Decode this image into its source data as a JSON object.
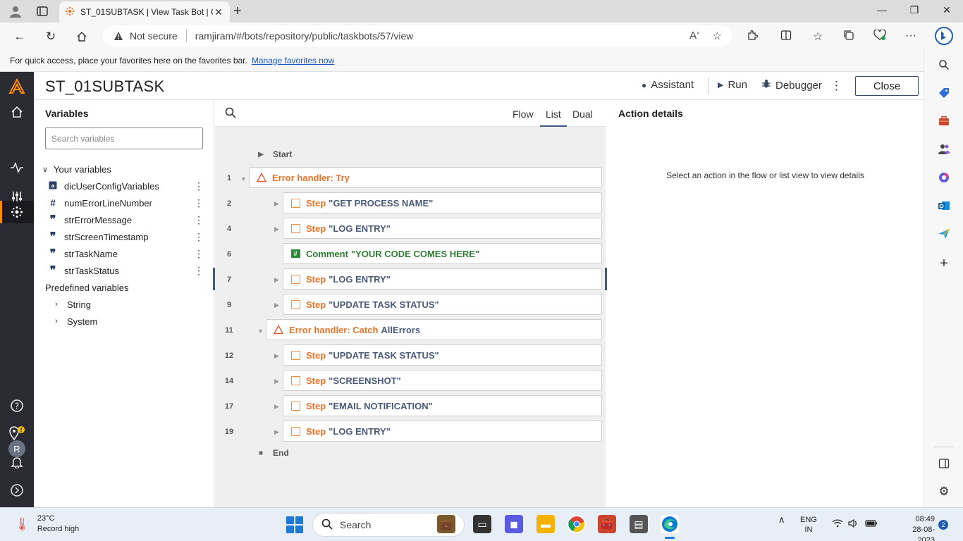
{
  "browser": {
    "tab_title": "ST_01SUBTASK | View Task Bot | C",
    "not_secure": "Not secure",
    "url": "ramjiram/#/bots/repository/public/taskbots/57/view",
    "favbar_text": "For quick access, place your favorites here on the favorites bar.",
    "favbar_link": "Manage favorites now"
  },
  "app": {
    "bot_title": "ST_01SUBTASK",
    "header": {
      "assistant": "Assistant",
      "run": "Run",
      "debugger": "Debugger",
      "close": "Close"
    },
    "avatar_initial": "R"
  },
  "variables": {
    "title": "Variables",
    "search_placeholder": "Search variables",
    "your_variables_label": "Your variables",
    "items": [
      {
        "name": "dicUserConfigVariables",
        "icon": "dictionary-icon"
      },
      {
        "name": "numErrorLineNumber",
        "icon": "number-icon"
      },
      {
        "name": "strErrorMessage",
        "icon": "string-icon"
      },
      {
        "name": "strScreenTimestamp",
        "icon": "string-icon"
      },
      {
        "name": "strTaskName",
        "icon": "string-icon"
      },
      {
        "name": "strTaskStatus",
        "icon": "string-icon"
      }
    ],
    "predefined_label": "Predefined variables",
    "predefined": [
      "String",
      "System"
    ]
  },
  "list_view": {
    "tabs": [
      "Flow",
      "List",
      "Dual"
    ],
    "active_tab": "List",
    "start": "Start",
    "end": "End",
    "rows": [
      {
        "line": "1",
        "kind": "error",
        "keyword": "Error handler: Try",
        "text": ""
      },
      {
        "line": "2",
        "kind": "step",
        "keyword": "Step",
        "text": "\"GET PROCESS NAME\""
      },
      {
        "line": "4",
        "kind": "step",
        "keyword": "Step",
        "text": "\"LOG ENTRY\""
      },
      {
        "line": "6",
        "kind": "comment",
        "keyword": "Comment",
        "text": "\"YOUR CODE COMES HERE\""
      },
      {
        "line": "7",
        "kind": "step",
        "keyword": "Step",
        "text": "\"LOG ENTRY\""
      },
      {
        "line": "9",
        "kind": "step",
        "keyword": "Step",
        "text": "\"UPDATE TASK STATUS\""
      },
      {
        "line": "11",
        "kind": "error",
        "keyword": "Error handler: Catch",
        "text": "AllErrors"
      },
      {
        "line": "12",
        "kind": "step",
        "keyword": "Step",
        "text": "\"UPDATE TASK STATUS\""
      },
      {
        "line": "14",
        "kind": "step",
        "keyword": "Step",
        "text": "\"SCREENSHOT\""
      },
      {
        "line": "17",
        "kind": "step",
        "keyword": "Step",
        "text": "\"EMAIL NOTIFICATION\""
      },
      {
        "line": "19",
        "kind": "step",
        "keyword": "Step",
        "text": "\"LOG ENTRY\""
      }
    ]
  },
  "details": {
    "title": "Action details",
    "message": "Select an action in the flow or list view to view details"
  },
  "taskbar": {
    "temperature": "23°C",
    "weather_note": "Record high",
    "search": "Search",
    "lang1": "ENG",
    "lang2": "IN",
    "time": "08:49",
    "date": "28-08-2023",
    "notifications": "2"
  }
}
